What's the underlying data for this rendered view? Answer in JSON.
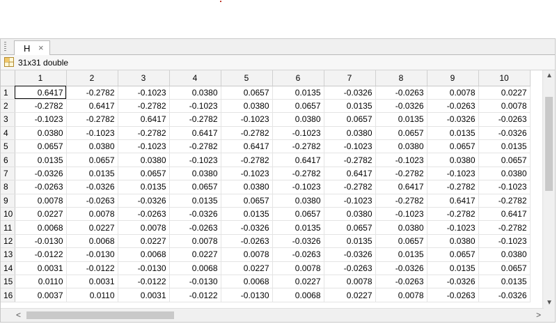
{
  "tab": {
    "label": "H",
    "close": "×"
  },
  "variable_info": "31x31 double",
  "columns": [
    "1",
    "2",
    "3",
    "4",
    "5",
    "6",
    "7",
    "8",
    "9",
    "10"
  ],
  "rows": [
    {
      "header": "1",
      "cells": [
        "0.6417",
        "-0.2782",
        "-0.1023",
        "0.0380",
        "0.0657",
        "0.0135",
        "-0.0326",
        "-0.0263",
        "0.0078",
        "0.0227"
      ]
    },
    {
      "header": "2",
      "cells": [
        "-0.2782",
        "0.6417",
        "-0.2782",
        "-0.1023",
        "0.0380",
        "0.0657",
        "0.0135",
        "-0.0326",
        "-0.0263",
        "0.0078"
      ]
    },
    {
      "header": "3",
      "cells": [
        "-0.1023",
        "-0.2782",
        "0.6417",
        "-0.2782",
        "-0.1023",
        "0.0380",
        "0.0657",
        "0.0135",
        "-0.0326",
        "-0.0263"
      ]
    },
    {
      "header": "4",
      "cells": [
        "0.0380",
        "-0.1023",
        "-0.2782",
        "0.6417",
        "-0.2782",
        "-0.1023",
        "0.0380",
        "0.0657",
        "0.0135",
        "-0.0326"
      ]
    },
    {
      "header": "5",
      "cells": [
        "0.0657",
        "0.0380",
        "-0.1023",
        "-0.2782",
        "0.6417",
        "-0.2782",
        "-0.1023",
        "0.0380",
        "0.0657",
        "0.0135"
      ]
    },
    {
      "header": "6",
      "cells": [
        "0.0135",
        "0.0657",
        "0.0380",
        "-0.1023",
        "-0.2782",
        "0.6417",
        "-0.2782",
        "-0.1023",
        "0.0380",
        "0.0657"
      ]
    },
    {
      "header": "7",
      "cells": [
        "-0.0326",
        "0.0135",
        "0.0657",
        "0.0380",
        "-0.1023",
        "-0.2782",
        "0.6417",
        "-0.2782",
        "-0.1023",
        "0.0380"
      ]
    },
    {
      "header": "8",
      "cells": [
        "-0.0263",
        "-0.0326",
        "0.0135",
        "0.0657",
        "0.0380",
        "-0.1023",
        "-0.2782",
        "0.6417",
        "-0.2782",
        "-0.1023"
      ]
    },
    {
      "header": "9",
      "cells": [
        "0.0078",
        "-0.0263",
        "-0.0326",
        "0.0135",
        "0.0657",
        "0.0380",
        "-0.1023",
        "-0.2782",
        "0.6417",
        "-0.2782"
      ]
    },
    {
      "header": "10",
      "cells": [
        "0.0227",
        "0.0078",
        "-0.0263",
        "-0.0326",
        "0.0135",
        "0.0657",
        "0.0380",
        "-0.1023",
        "-0.2782",
        "0.6417"
      ]
    },
    {
      "header": "11",
      "cells": [
        "0.0068",
        "0.0227",
        "0.0078",
        "-0.0263",
        "-0.0326",
        "0.0135",
        "0.0657",
        "0.0380",
        "-0.1023",
        "-0.2782"
      ]
    },
    {
      "header": "12",
      "cells": [
        "-0.0130",
        "0.0068",
        "0.0227",
        "0.0078",
        "-0.0263",
        "-0.0326",
        "0.0135",
        "0.0657",
        "0.0380",
        "-0.1023"
      ]
    },
    {
      "header": "13",
      "cells": [
        "-0.0122",
        "-0.0130",
        "0.0068",
        "0.0227",
        "0.0078",
        "-0.0263",
        "-0.0326",
        "0.0135",
        "0.0657",
        "0.0380"
      ]
    },
    {
      "header": "14",
      "cells": [
        "0.0031",
        "-0.0122",
        "-0.0130",
        "0.0068",
        "0.0227",
        "0.0078",
        "-0.0263",
        "-0.0326",
        "0.0135",
        "0.0657"
      ]
    },
    {
      "header": "15",
      "cells": [
        "0.0110",
        "0.0031",
        "-0.0122",
        "-0.0130",
        "0.0068",
        "0.0227",
        "0.0078",
        "-0.0263",
        "-0.0326",
        "0.0135"
      ]
    },
    {
      "header": "16",
      "cells": [
        "0.0037",
        "0.0110",
        "0.0031",
        "-0.0122",
        "-0.0130",
        "0.0068",
        "0.0227",
        "0.0078",
        "-0.0263",
        "-0.0326"
      ]
    }
  ],
  "selected_cell": {
    "row": 1,
    "column": 1
  },
  "icons": {
    "grip": "tab-grip-icon",
    "variable": "grid-table-icon",
    "scroll_up": "scroll-up-arrow-icon",
    "scroll_down": "scroll-down-arrow-icon",
    "scroll_left": "scroll-left-arrow-icon",
    "scroll_right": "scroll-right-arrow-icon"
  },
  "colors": {
    "grid_line": "#e4e4e4",
    "header_bg": "#f3f3f3",
    "chrome_bg": "#f0f0f0"
  }
}
